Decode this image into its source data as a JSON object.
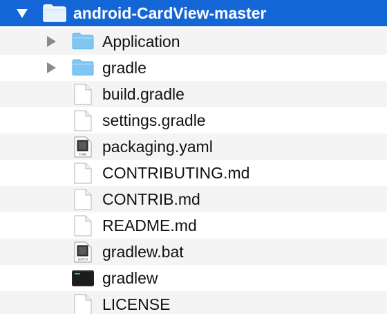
{
  "root": {
    "name": "android-CardView-master",
    "expanded": true,
    "icon": "folder-icon"
  },
  "items": [
    {
      "name": "Application",
      "kind": "folder",
      "icon": "folder-icon",
      "expanded": false
    },
    {
      "name": "gradle",
      "kind": "folder",
      "icon": "folder-icon",
      "expanded": false
    },
    {
      "name": "build.gradle",
      "kind": "file",
      "icon": "document-icon"
    },
    {
      "name": "settings.gradle",
      "kind": "file",
      "icon": "document-icon"
    },
    {
      "name": "packaging.yaml",
      "kind": "file",
      "icon": "yaml-file-icon",
      "badge": "YAML"
    },
    {
      "name": "CONTRIBUTING.md",
      "kind": "file",
      "icon": "document-icon"
    },
    {
      "name": "CONTRIB.md",
      "kind": "file",
      "icon": "document-icon"
    },
    {
      "name": "README.md",
      "kind": "file",
      "icon": "document-icon"
    },
    {
      "name": "gradlew.bat",
      "kind": "file",
      "icon": "batch-file-icon",
      "badge": "BATCH"
    },
    {
      "name": "gradlew",
      "kind": "file",
      "icon": "terminal-executable-icon"
    },
    {
      "name": "LICENSE",
      "kind": "file",
      "icon": "document-icon"
    }
  ],
  "colors": {
    "selection": "#1466d6",
    "row_alt": "#f4f4f4",
    "folder_blue": "#7fc6f2"
  }
}
